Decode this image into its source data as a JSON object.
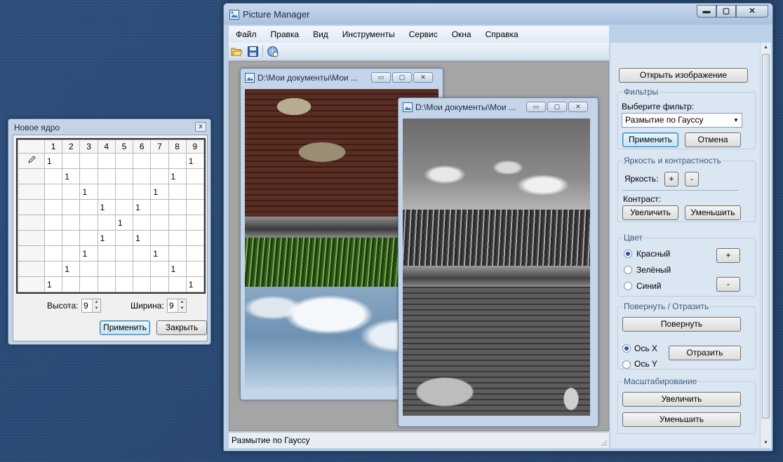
{
  "kernel_dialog": {
    "title": "Новое ядро",
    "close_glyph": "x",
    "col_headers": [
      "1",
      "2",
      "3",
      "4",
      "5",
      "6",
      "7",
      "8",
      "9"
    ],
    "rows": [
      [
        "1",
        "",
        "",
        "",
        "",
        "",
        "",
        "",
        "1"
      ],
      [
        "",
        "1",
        "",
        "",
        "",
        "",
        "",
        "1",
        ""
      ],
      [
        "",
        "",
        "1",
        "",
        "",
        "",
        "1",
        "",
        ""
      ],
      [
        "",
        "",
        "",
        "1",
        "",
        "1",
        "",
        "",
        ""
      ],
      [
        "",
        "",
        "",
        "",
        "1",
        "",
        "",
        "",
        ""
      ],
      [
        "",
        "",
        "",
        "1",
        "",
        "1",
        "",
        "",
        ""
      ],
      [
        "",
        "",
        "1",
        "",
        "",
        "",
        "1",
        "",
        ""
      ],
      [
        "",
        "1",
        "",
        "",
        "",
        "",
        "",
        "1",
        ""
      ],
      [
        "1",
        "",
        "",
        "",
        "",
        "",
        "",
        "",
        "1"
      ]
    ],
    "height_label": "Высота:",
    "height_value": "9",
    "width_label": "Ширина:",
    "width_value": "9",
    "apply_label": "Применить",
    "close_label": "Закрыть"
  },
  "main_window": {
    "title": "Picture Manager",
    "controls": {
      "minimize": "▬",
      "maximize": "▢",
      "close": "✕"
    },
    "menu": [
      "Файл",
      "Правка",
      "Вид",
      "Инструменты",
      "Сервис",
      "Окна",
      "Справка"
    ],
    "toolbar_icons": [
      "open-folder-icon",
      "save-disk-icon",
      "help-globe-icon"
    ],
    "status_text": "Размытие по Гауссу"
  },
  "child_windows": [
    {
      "title": "D:\\Мои документы\\Мои ...",
      "buttons": [
        "▭",
        "▢",
        "✕"
      ]
    },
    {
      "title": "D:\\Мои документы\\Мои ...",
      "buttons": [
        "▭",
        "▢",
        "✕"
      ]
    }
  ],
  "panel": {
    "open_image_label": "Открыть изображение",
    "filters": {
      "title": "Фильтры",
      "choose_label": "Выберите фильтр:",
      "selected": "Размытие по Гауссу",
      "apply": "Применить",
      "cancel": "Отмена"
    },
    "brightness_contrast": {
      "title": "Яркость и контрастность",
      "brightness_label": "Яркость:",
      "plus": "+",
      "minus": "-",
      "contrast_label": "Контраст:",
      "increase": "Увеличить",
      "decrease": "Уменьшить"
    },
    "color": {
      "title": "Цвет",
      "options": [
        "Красный",
        "Зелёный",
        "Синий"
      ],
      "selected": "Красный",
      "plus": "+",
      "minus": "-"
    },
    "rotate_flip": {
      "title": "Повернуть / Отразить",
      "rotate": "Повернуть",
      "axis_options": [
        "Ось X",
        "Ось Y"
      ],
      "selected_axis": "Ось X",
      "flip": "Отразить"
    },
    "scale": {
      "title": "Масштабирование",
      "zoom_in": "Увеличить",
      "zoom_out": "Уменьшить"
    }
  },
  "colors": {
    "accent": "#3c7fb1",
    "desktop": "#2b4a74"
  }
}
